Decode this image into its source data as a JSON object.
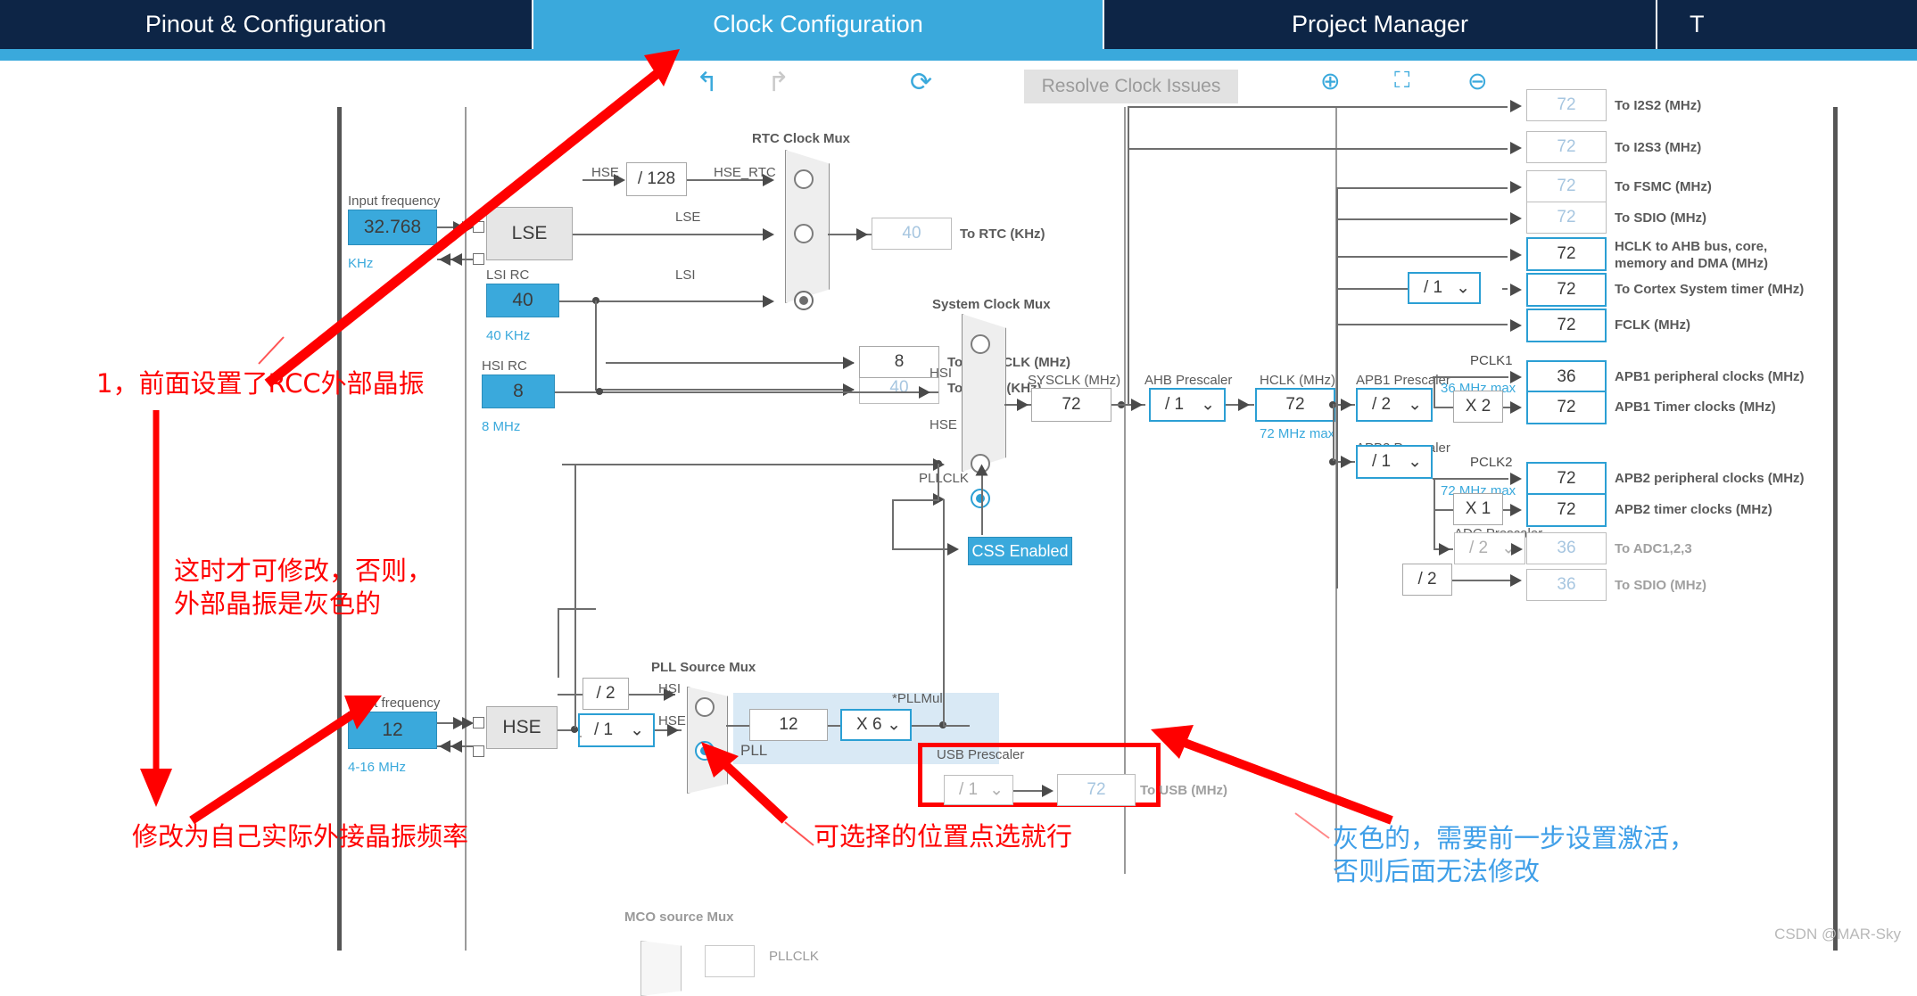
{
  "tabs": [
    {
      "label": "Pinout & Configuration",
      "active": false
    },
    {
      "label": "Clock Configuration",
      "active": true
    },
    {
      "label": "Project Manager",
      "active": false
    },
    {
      "label": "T",
      "active": false
    }
  ],
  "toolbar": {
    "undo_icon": "↰",
    "redo_icon": "↱",
    "reset_icon": "⟳",
    "resolve_label": "Resolve Clock Issues",
    "zoom_in_icon": "⊕",
    "fit_icon": "⛶",
    "zoom_out_icon": "⊖"
  },
  "clock": {
    "lse": {
      "input_frequency_label": "Input frequency",
      "value": "32.768",
      "unit": "KHz",
      "source_label": "LSE"
    },
    "lsi": {
      "title": "LSI RC",
      "value": "40",
      "unit": "40 KHz"
    },
    "hse_div128": {
      "label": "/ 128",
      "in_signal": "HSE",
      "out_signal": "HSE_RTC"
    },
    "rtc_mux": {
      "title": "RTC Clock Mux",
      "inputs": [
        "HSE_RTC",
        "LSE",
        "LSI"
      ],
      "selected_index": 2
    },
    "to_rtc": {
      "value": "40",
      "label": "To RTC (KHz)"
    },
    "to_iwdg": {
      "value": "40",
      "label": "To IWDG (KHz)"
    },
    "to_flitfclk": {
      "value": "8",
      "label": "To FLITFCLK (MHz)"
    },
    "hsi": {
      "title": "HSI RC",
      "value": "8",
      "unit": "8 MHz"
    },
    "sys_mux": {
      "title": "System Clock Mux",
      "inputs": [
        "HSI",
        "HSE",
        "PLLCLK"
      ],
      "selected_index": 2
    },
    "css": {
      "label": "CSS Enabled"
    },
    "sysclk": {
      "title": "SYSCLK (MHz)",
      "value": "72"
    },
    "ahb_prescaler": {
      "title": "AHB Prescaler",
      "value": "/ 1"
    },
    "hclk": {
      "title": "HCLK (MHz)",
      "value": "72",
      "note": "72 MHz max"
    },
    "apb1_prescaler": {
      "title": "APB1 Prescaler",
      "value": "/ 2",
      "pclk": "PCLK1",
      "note": "36 MHz max",
      "mult": "X 2"
    },
    "apb2_prescaler": {
      "title": "APB2 Prescaler",
      "value": "/ 1",
      "pclk": "PCLK2",
      "note": "72 MHz max",
      "mult": "X 1"
    },
    "adc_prescaler": {
      "title": "ADC Prescaler",
      "value": "/ 2"
    },
    "sdio_div": {
      "value": "/ 2"
    },
    "hse": {
      "input_frequency_label": "Input frequency",
      "value": "12",
      "unit": "4-16 MHz",
      "source_label": "HSE",
      "prescaler": "/ 1"
    },
    "pll_div2": {
      "label": "/ 2"
    },
    "pll_mux": {
      "title": "PLL Source Mux",
      "inputs": [
        "HSI",
        "HSE"
      ],
      "selected_index": 1
    },
    "pll": {
      "panel_label": "PLL",
      "input_value": "12",
      "mul_label": "*PLLMul",
      "mul_value": "X 6"
    },
    "usb": {
      "title": "USB Prescaler",
      "prescaler": "/ 1",
      "value": "72",
      "label": "To USB (MHz)"
    },
    "mco_mux": {
      "title": "MCO source Mux",
      "signal": "PLLCLK"
    },
    "outputs": [
      {
        "value": "72",
        "label": "To I2S2 (MHz)",
        "enabled": false
      },
      {
        "value": "72",
        "label": "To I2S3 (MHz)",
        "enabled": false
      },
      {
        "value": "72",
        "label": "To FSMC (MHz)",
        "enabled": false
      },
      {
        "value": "72",
        "label": "To SDIO (MHz)",
        "enabled": false
      },
      {
        "value": "72",
        "label": "HCLK to AHB bus, core,\nmemory and DMA (MHz)",
        "enabled": true
      },
      {
        "value": "72",
        "label": "To Cortex System timer (MHz)",
        "enabled": true
      },
      {
        "value": "72",
        "label": "FCLK (MHz)",
        "enabled": true
      },
      {
        "value": "36",
        "label": "APB1 peripheral clocks (MHz)",
        "enabled": true
      },
      {
        "value": "72",
        "label": "APB1 Timer clocks (MHz)",
        "enabled": true
      },
      {
        "value": "72",
        "label": "APB2 peripheral clocks (MHz)",
        "enabled": true
      },
      {
        "value": "72",
        "label": "APB2 timer clocks (MHz)",
        "enabled": true
      },
      {
        "value": "36",
        "label": "To ADC1,2,3",
        "enabled": false
      },
      {
        "value": "36",
        "label": "To SDIO (MHz)",
        "enabled": false
      }
    ]
  },
  "annotations": {
    "a1": "1，前面设置了RCC外部晶振",
    "a2": "这时才可修改，否则，\n外部晶振是灰色的",
    "a3": "修改为自己实际外接晶振频率",
    "a4": "可选择的位置点选就行",
    "a5": "灰色的，需要前一步设置激活，\n否则后面无法修改"
  },
  "watermark": "CSDN @MAR-Sky",
  "colors": {
    "tab_bg": "#0d2546",
    "tab_active": "#3aa9dc",
    "accent": "#2b9fd4",
    "annotation_red": "#ff0000",
    "annotation_blue": "#3f9fe8"
  }
}
